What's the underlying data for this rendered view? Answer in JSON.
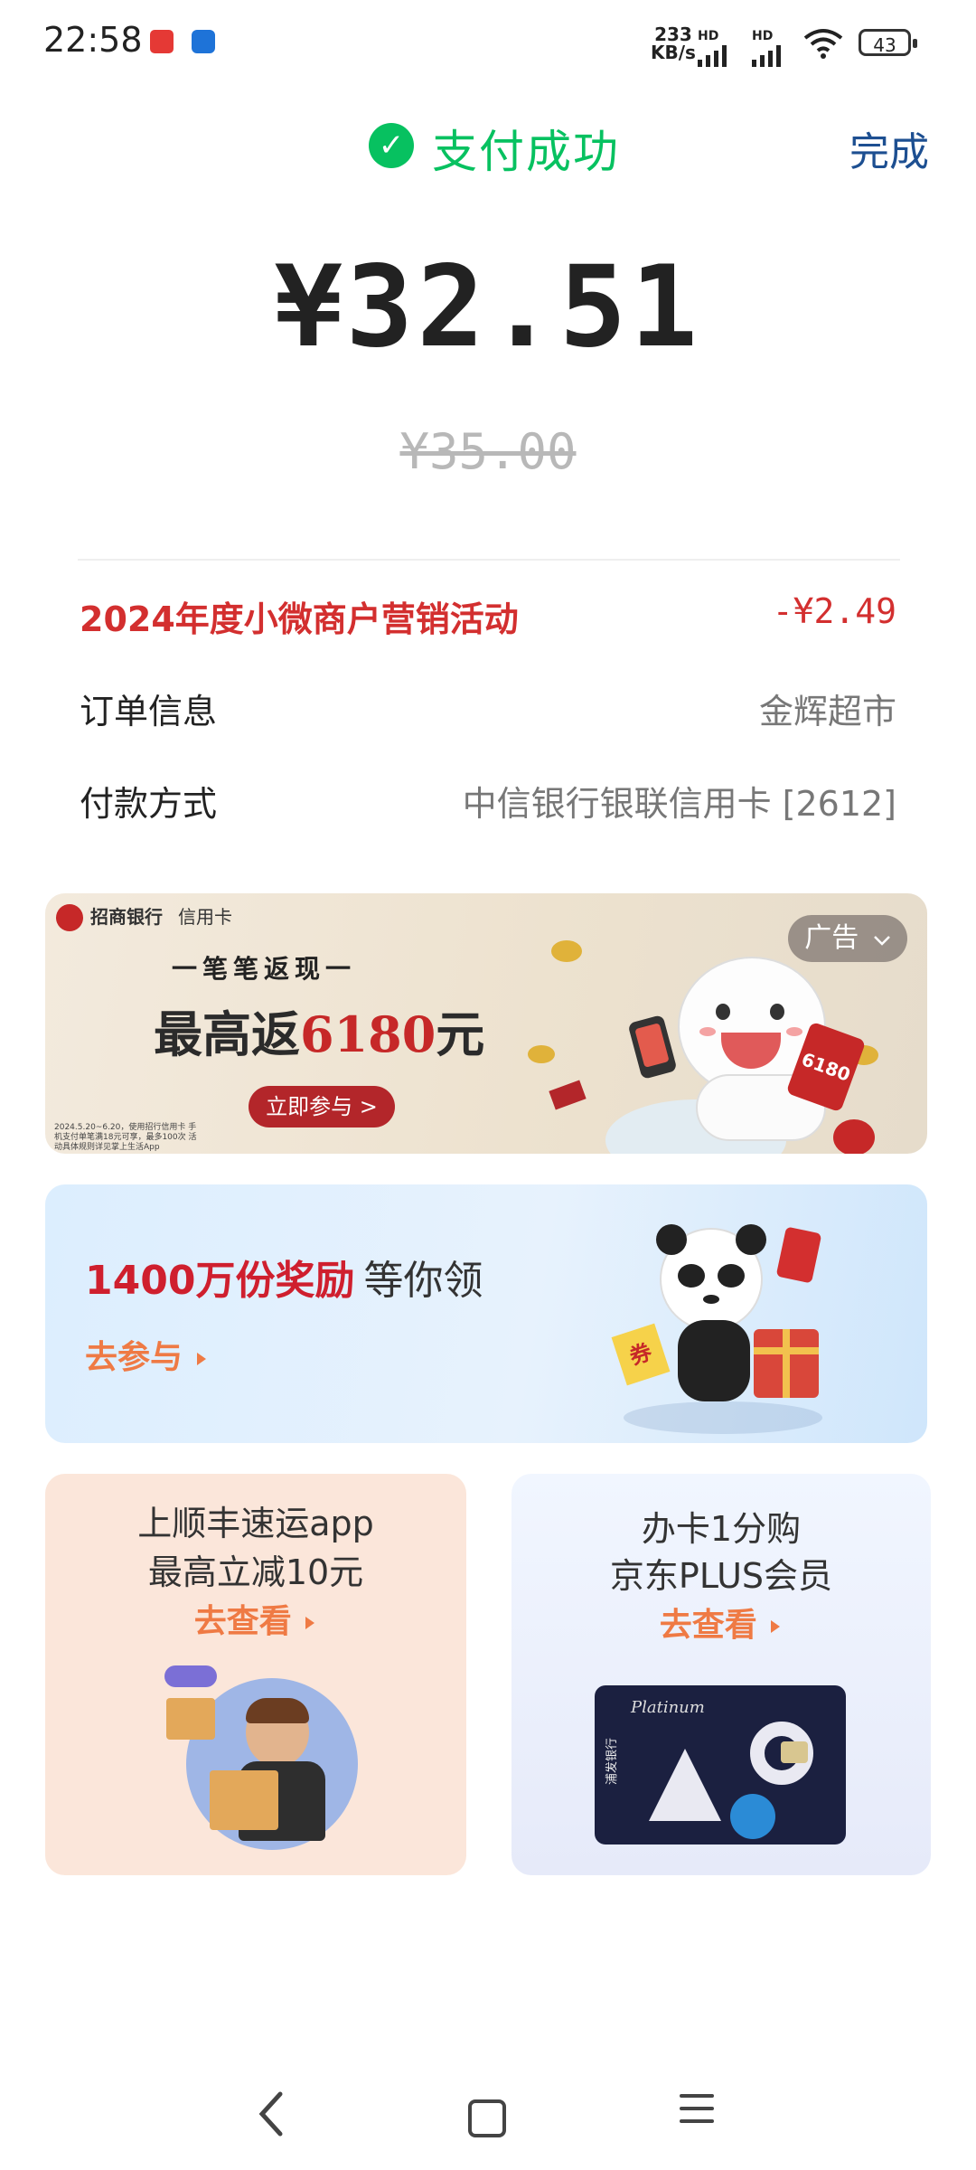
{
  "status_bar": {
    "time": "22:58",
    "network_speed_value": "233",
    "network_speed_unit": "KB/s",
    "signal_label_1": "HD",
    "signal_label_2": "HD",
    "battery": "43"
  },
  "header": {
    "title": "支付成功",
    "done_label": "完成",
    "accent_color": "#07c160"
  },
  "payment": {
    "amount": "¥32.51",
    "original_amount": "¥35.00"
  },
  "details": [
    {
      "label": "2024年度小微商户营销活动",
      "value": "-¥2.49",
      "highlight": true
    },
    {
      "label": "订单信息",
      "value": "金辉超市",
      "highlight": false
    },
    {
      "label": "付款方式",
      "value": "中信银行银联信用卡 [2612]",
      "highlight": false
    }
  ],
  "ad_banner": {
    "bank_name": "招商银行",
    "bank_sub": "信用卡",
    "subtitle": "一笔笔返现一",
    "headline_prefix": "最高返",
    "headline_amount": "6180",
    "headline_suffix": "元",
    "cta": "立即参与 >",
    "fine_print": "2024.5.20~6.20，使用招行信用卡 手机支付单笔满18元可享，最多100次 活动具体规则详见掌上生活App",
    "ad_tag": "广告",
    "mascot_tag": "6180"
  },
  "reward_banner": {
    "title_highlight": "1400万份奖励",
    "title_rest": "等你领",
    "link": "去参与",
    "coupon_text": "券"
  },
  "card_left": {
    "line1": "上顺丰速运app",
    "line2": "最高立减10元",
    "link": "去查看"
  },
  "card_right": {
    "line1": "办卡1分购",
    "line2": "京东PLUS会员",
    "link": "去查看",
    "card_brand": "Platinum",
    "card_bank": "浦发银行"
  },
  "nav_bar": {
    "back_icon": "chevron-left-icon",
    "home_icon": "square-home-icon",
    "menu_icon": "hamburger-menu-icon"
  }
}
